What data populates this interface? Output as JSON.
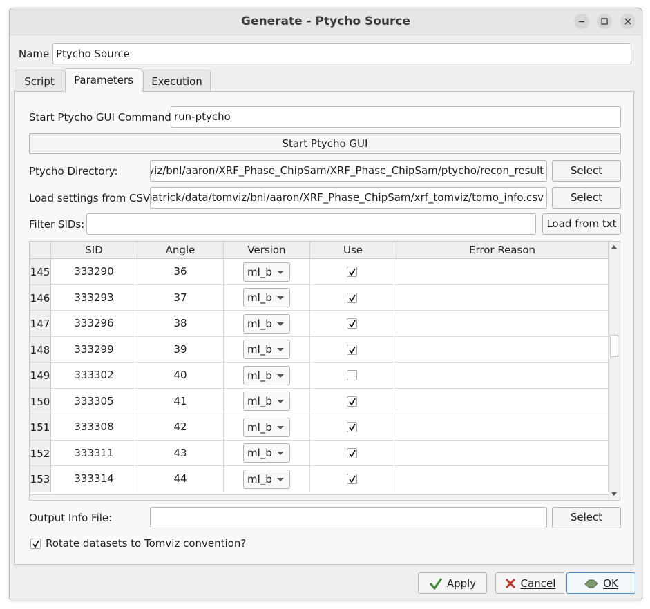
{
  "window": {
    "title": "Generate - Ptycho Source"
  },
  "name_label": "Name",
  "name_value": "Ptycho Source",
  "tabs": [
    {
      "label": "Script"
    },
    {
      "label": "Parameters"
    },
    {
      "label": "Execution"
    }
  ],
  "params": {
    "start_cmd_label": "Start Ptycho GUI Command:",
    "start_cmd_value": "run-ptycho",
    "start_gui_button": "Start Ptycho GUI",
    "ptycho_dir_label": "Ptycho Directory:",
    "ptycho_dir_value": "tomviz/bnl/aaron/XRF_Phase_ChipSam/XRF_Phase_ChipSam/ptycho/recon_result",
    "csv_label": "Load settings from CSV:",
    "csv_value": "me/patrick/data/tomviz/bnl/aaron/XRF_Phase_ChipSam/xrf_tomviz/tomo_info.csv",
    "select_label": "Select",
    "filter_label": "Filter SIDs:",
    "filter_value": "",
    "load_txt_button": "Load from txt",
    "output_label": "Output Info File:",
    "output_value": "",
    "rotate_label": "Rotate datasets to Tomviz convention?",
    "rotate_checked": true
  },
  "table": {
    "columns": [
      "SID",
      "Angle",
      "Version",
      "Use",
      "Error Reason"
    ],
    "rows": [
      {
        "index": "145",
        "sid": "333290",
        "angle": "36",
        "version": "ml_b",
        "use": true,
        "error": ""
      },
      {
        "index": "146",
        "sid": "333293",
        "angle": "37",
        "version": "ml_b",
        "use": true,
        "error": ""
      },
      {
        "index": "147",
        "sid": "333296",
        "angle": "38",
        "version": "ml_b",
        "use": true,
        "error": ""
      },
      {
        "index": "148",
        "sid": "333299",
        "angle": "39",
        "version": "ml_b",
        "use": true,
        "error": ""
      },
      {
        "index": "149",
        "sid": "333302",
        "angle": "40",
        "version": "ml_b",
        "use": false,
        "error": ""
      },
      {
        "index": "150",
        "sid": "333305",
        "angle": "41",
        "version": "ml_b",
        "use": true,
        "error": ""
      },
      {
        "index": "151",
        "sid": "333308",
        "angle": "42",
        "version": "ml_b",
        "use": true,
        "error": ""
      },
      {
        "index": "152",
        "sid": "333311",
        "angle": "43",
        "version": "ml_b",
        "use": true,
        "error": ""
      },
      {
        "index": "153",
        "sid": "333314",
        "angle": "44",
        "version": "ml_b",
        "use": true,
        "error": ""
      }
    ]
  },
  "buttons": {
    "apply": "Apply",
    "cancel": "Cancel",
    "ok": "OK"
  },
  "icons": {
    "minimize": "minimize-icon",
    "maximize": "maximize-icon",
    "close": "close-icon",
    "apply": "checkmark-icon",
    "cancel": "x-icon",
    "ok": "ok-icon"
  },
  "colors": {
    "apply_icon": "#3c8d2f",
    "cancel_icon": "#c0392b",
    "ok_border": "#3d8fd6"
  }
}
